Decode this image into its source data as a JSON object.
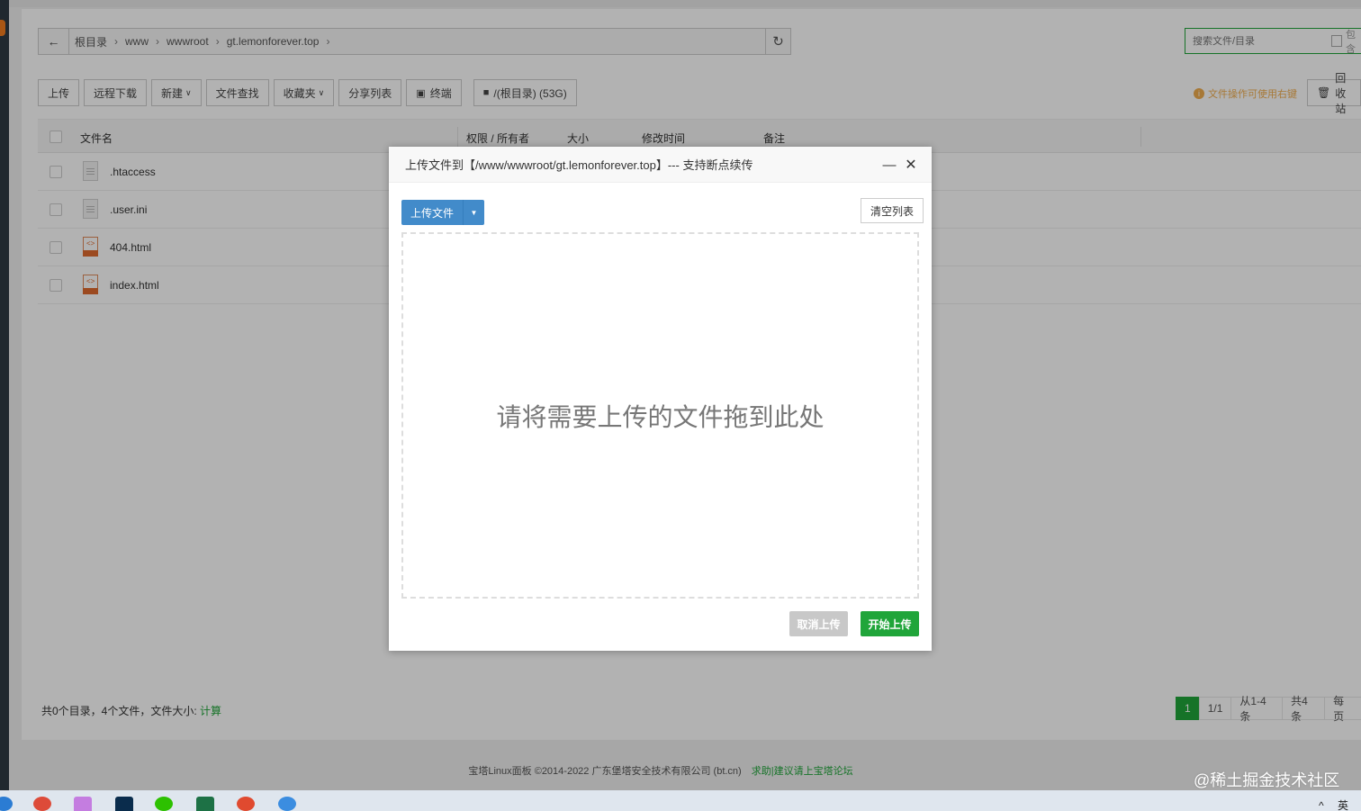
{
  "breadcrumb": {
    "items": [
      "根目录",
      "www",
      "wwwroot",
      "gt.lemonforever.top"
    ]
  },
  "search": {
    "placeholder": "搜索文件/目录",
    "include_label": "包含"
  },
  "toolbar": {
    "upload": "上传",
    "remote_download": "远程下载",
    "new": "新建",
    "file_search": "文件查找",
    "favorites": "收藏夹",
    "share_list": "分享列表",
    "terminal": "终端",
    "disk": "/(根目录) (53G)",
    "hint": "文件操作可使用右键",
    "recycle": "回收站"
  },
  "table": {
    "headers": [
      "文件名",
      "权限 / 所有者",
      "大小",
      "修改时间",
      "备注"
    ],
    "rows": [
      {
        "name": ".htaccess",
        "type": "file"
      },
      {
        "name": ".user.ini",
        "type": "file"
      },
      {
        "name": "404.html",
        "type": "html"
      },
      {
        "name": "index.html",
        "type": "html"
      }
    ]
  },
  "summary": {
    "text": "共0个目录，4个文件，文件大小:",
    "calc_link": "计算"
  },
  "pager": {
    "current": "1",
    "pages": "1/1",
    "range": "从1-4条",
    "total": "共4条",
    "per_page": "每页"
  },
  "footer": {
    "copyright": "宝塔Linux面板 ©2014-2022 广东堡塔安全技术有限公司 (bt.cn)",
    "help_link": "求助|建议请上宝塔论坛"
  },
  "watermark": "@稀土掘金技术社区",
  "modal": {
    "title": "上传文件到【/www/wwwroot/gt.lemonforever.top】--- 支持断点续传",
    "upload_button": "上传文件",
    "clear_button": "清空列表",
    "drop_text": "请将需要上传的文件拖到此处",
    "cancel_button": "取消上传",
    "start_button": "开始上传"
  },
  "taskbar": {
    "tray": "^ 英"
  }
}
